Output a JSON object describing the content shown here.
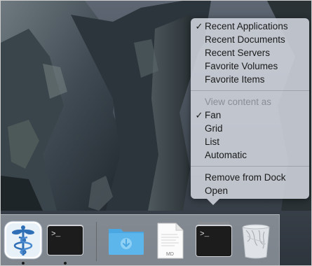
{
  "context_menu": {
    "items": [
      {
        "label": "Recent Applications",
        "checked": true
      },
      {
        "label": "Recent Documents",
        "checked": false
      },
      {
        "label": "Recent Servers",
        "checked": false
      },
      {
        "label": "Favorite Volumes",
        "checked": false
      },
      {
        "label": "Favorite Items",
        "checked": false
      }
    ],
    "view_section_title": "View content as",
    "view_options": [
      {
        "label": "Fan",
        "checked": true
      },
      {
        "label": "Grid",
        "checked": false
      },
      {
        "label": "List",
        "checked": false
      },
      {
        "label": "Automatic",
        "checked": false
      }
    ],
    "actions": [
      {
        "label": "Remove from Dock"
      },
      {
        "label": "Open"
      }
    ],
    "check_glyph": "✓"
  },
  "dock": {
    "apps": [
      {
        "name": "medical-caduceus-app",
        "icon": "caduceus-icon",
        "running": true
      },
      {
        "name": "terminal",
        "icon": "terminal-icon",
        "running": true
      }
    ],
    "stacks": [
      {
        "name": "downloads-folder",
        "icon": "download-folder-icon"
      },
      {
        "name": "md-document",
        "icon": "document-icon",
        "badge": "MD"
      },
      {
        "name": "recent-applications-stack",
        "icon": "terminal-stack-icon"
      },
      {
        "name": "trash",
        "icon": "trash-icon"
      }
    ],
    "terminal_prompt": ">_"
  },
  "colors": {
    "menu_bg": "#cdd2da",
    "folder_blue": "#5cb6ec",
    "terminal_bg": "#1c1c1c",
    "caduceus_blue": "#2f6fb6"
  }
}
